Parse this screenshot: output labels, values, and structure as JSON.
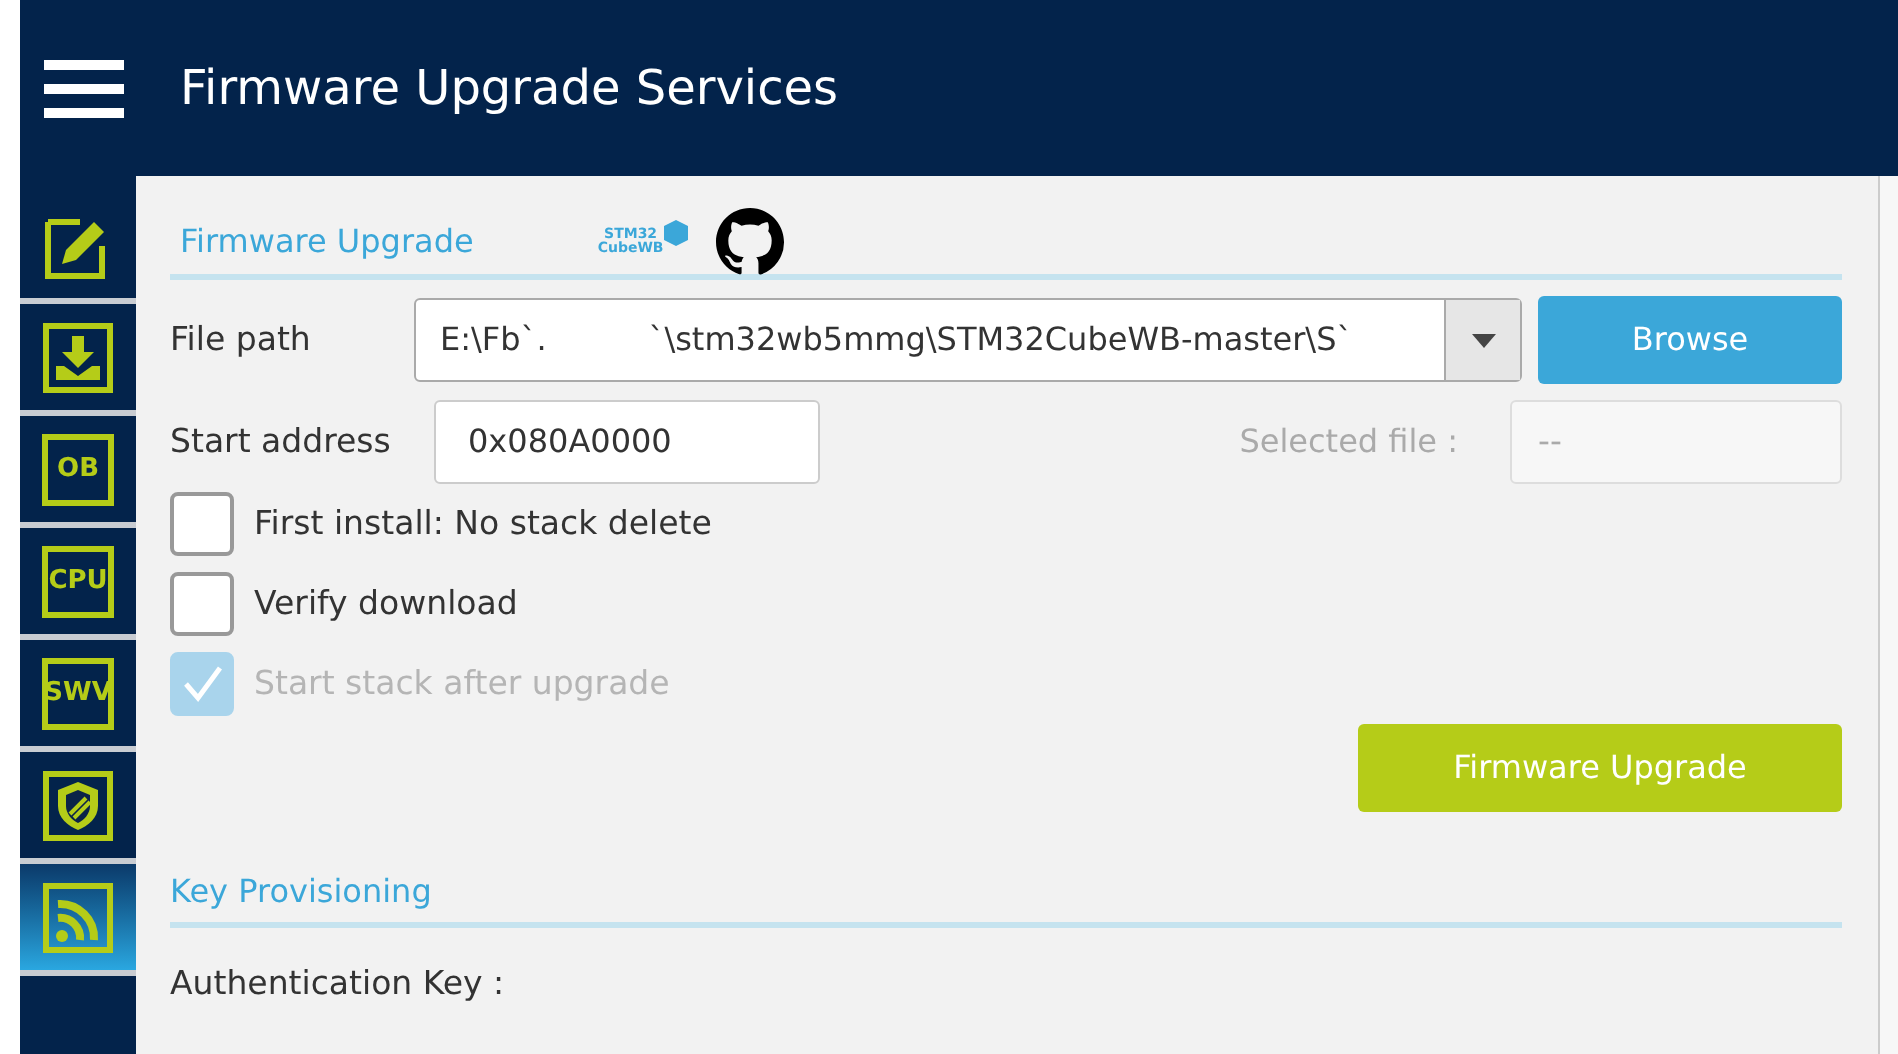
{
  "header": {
    "title": "Firmware Upgrade Services"
  },
  "sidebar": {
    "items": [
      {
        "kind": "edit",
        "selected": false
      },
      {
        "kind": "download",
        "selected": false
      },
      {
        "kind": "text",
        "label": "OB",
        "selected": false
      },
      {
        "kind": "text",
        "label": "CPU",
        "selected": false
      },
      {
        "kind": "text",
        "label": "SWV",
        "selected": false
      },
      {
        "kind": "shield",
        "selected": false
      },
      {
        "kind": "wireless",
        "selected": true
      }
    ]
  },
  "firmware_section": {
    "title": "Firmware Upgrade",
    "logo": {
      "line_1": "STM32",
      "line_2": "CubeWB"
    },
    "file_path": {
      "label": "File path",
      "value": "E:\\Fb`.          `\\stm32wb5mmg\\STM32CubeWB-master\\S`"
    },
    "browse_button": "Browse",
    "start_address": {
      "label": "Start address",
      "value": "0x080A0000"
    },
    "selected_file": {
      "label": "Selected file :",
      "value": "--"
    },
    "options": [
      {
        "label": "First install: No stack delete",
        "checked": false,
        "disabled": false
      },
      {
        "label": "Verify download",
        "checked": false,
        "disabled": false
      },
      {
        "label": "Start stack after upgrade",
        "checked": true,
        "disabled": true
      }
    ],
    "upgrade_button": "Firmware Upgrade"
  },
  "key_section": {
    "title": "Key Provisioning",
    "fields": [
      {
        "label": "Authentication Key :"
      }
    ]
  }
}
